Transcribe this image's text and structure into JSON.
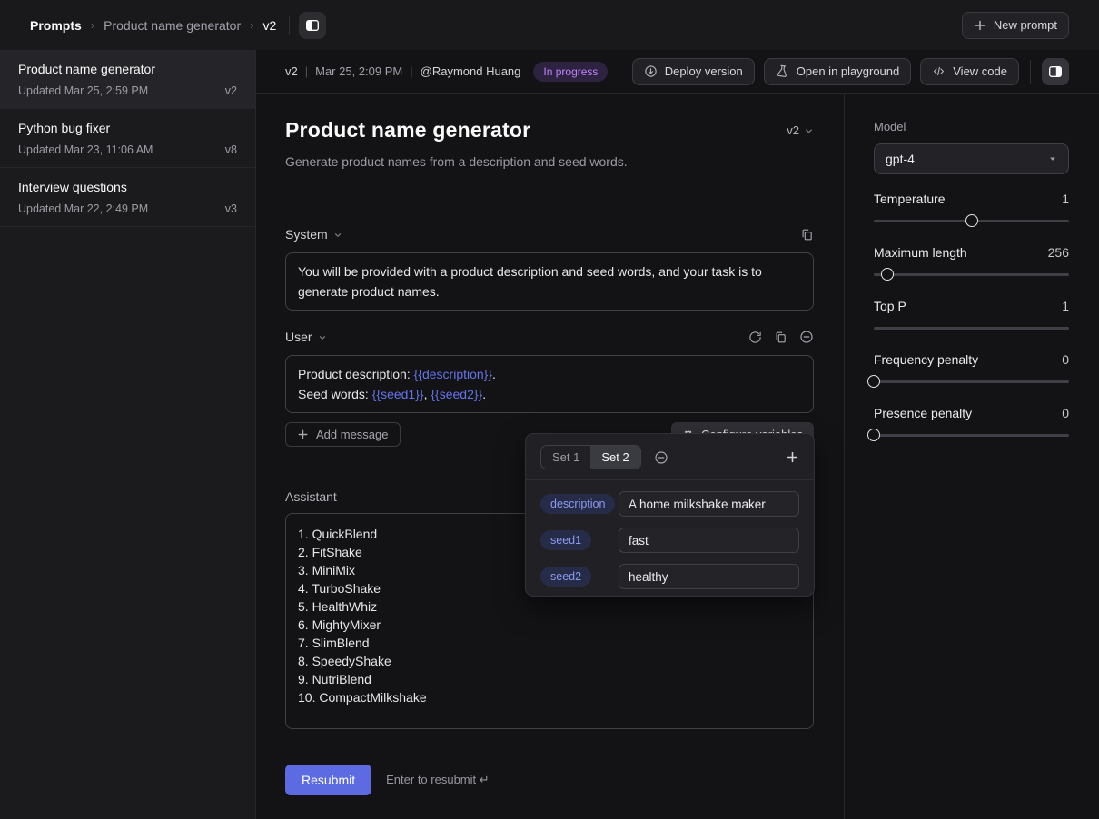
{
  "topbar": {
    "breadcrumb": {
      "root": "Prompts",
      "middle": "Product name generator",
      "leaf": "v2",
      "separator": "›"
    },
    "new_prompt_label": "New prompt"
  },
  "sidebar": {
    "items": [
      {
        "title": "Product name generator",
        "updated": "Updated Mar 25, 2:59 PM",
        "version": "v2"
      },
      {
        "title": "Python bug fixer",
        "updated": "Updated Mar 23, 11:06 AM",
        "version": "v8"
      },
      {
        "title": "Interview questions",
        "updated": "Updated Mar 22, 2:49 PM",
        "version": "v3"
      }
    ]
  },
  "header": {
    "version": "v2",
    "date": "Mar 25, 2:09 PM",
    "author": "@Raymond Huang",
    "separator": "|",
    "status": "In progress",
    "deploy_label": "Deploy version",
    "playground_label": "Open in playground",
    "view_code_label": "View code"
  },
  "main": {
    "title": "Product name generator",
    "version": "v2",
    "subtitle": "Generate product names from a description and seed words.",
    "system": {
      "label": "System",
      "content": "You will be provided with a product description and seed words, and your task is to generate product names."
    },
    "user": {
      "label": "User",
      "line1": {
        "prefix": "Product description: ",
        "var": "{{description}}",
        "suffix": "."
      },
      "line2": {
        "prefix": "Seed words: ",
        "var1": "{{seed1}}",
        "separator": ", ",
        "var2": "{{seed2}}",
        "suffix": "."
      }
    },
    "add_message_label": "Add message",
    "configure_variables_label": "Configure variables",
    "assistant": {
      "label": "Assistant",
      "items": [
        "1. QuickBlend",
        "2. FitShake",
        "3. MiniMix",
        "4. TurboShake",
        "5. HealthWhiz",
        "6. MightyMixer",
        "7. SlimBlend",
        "8. SpeedyShake",
        "9. NutriBlend",
        "10. CompactMilkshake"
      ]
    },
    "resubmit_label": "Resubmit",
    "resubmit_hint": "Enter to resubmit ↵"
  },
  "popover": {
    "tabs": [
      "Set 1",
      "Set 2"
    ],
    "active_tab": "Set 2",
    "variables": [
      {
        "name": "description",
        "value": "A home milkshake maker"
      },
      {
        "name": "seed1",
        "value": "fast"
      },
      {
        "name": "seed2",
        "value": "healthy"
      }
    ]
  },
  "settings": {
    "model_label": "Model",
    "model": "gpt-4",
    "params": [
      {
        "label": "Temperature",
        "value": "1",
        "pct": 50,
        "thumb": true
      },
      {
        "label": "Maximum length",
        "value": "256",
        "pct": 7,
        "thumb": true
      },
      {
        "label": "Top P",
        "value": "1",
        "pct": 100,
        "thumb": false
      },
      {
        "label": "Frequency penalty",
        "value": "0",
        "pct": 0,
        "thumb": true
      },
      {
        "label": "Presence penalty",
        "value": "0",
        "pct": 0,
        "thumb": true
      }
    ]
  },
  "colors": {
    "accent": "#5d6be3",
    "template_variable": "#6574e8",
    "status_badge_bg": "#2d2240",
    "status_badge_text": "#c084fc",
    "variable_pill_bg": "#262b47",
    "variable_pill_text": "#8c9cf0",
    "background": "#131316",
    "sidebar_background": "#1b1b1e"
  }
}
